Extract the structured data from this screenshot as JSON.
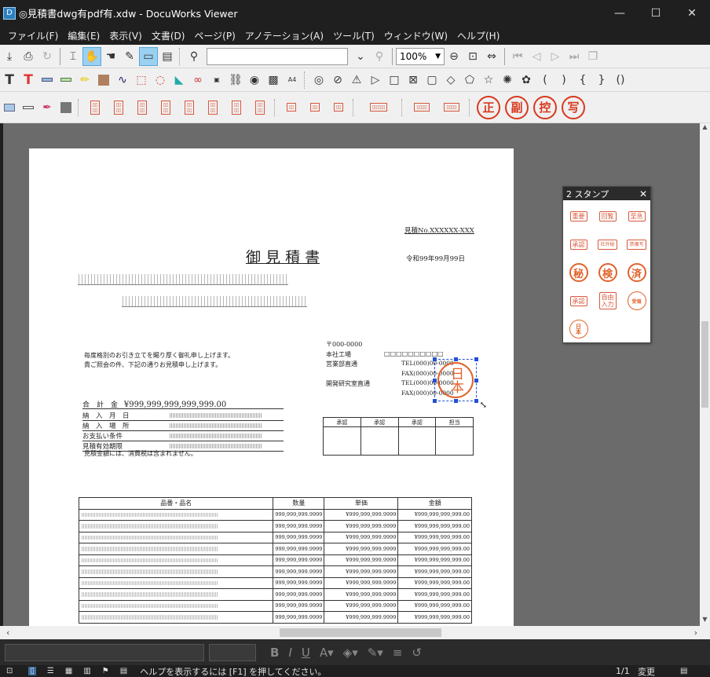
{
  "window": {
    "title": "◎見積書dwg有pdf有.xdw - DocuWorks Viewer",
    "app_icon": "docuworks-icon",
    "minimize": "—",
    "maximize": "☐",
    "close": "✕"
  },
  "menu": [
    "ファイル(F)",
    "編集(E)",
    "表示(V)",
    "文書(D)",
    "ページ(P)",
    "アノテーション(A)",
    "ツール(T)",
    "ウィンドウ(W)",
    "ヘルプ(H)"
  ],
  "toolbar": {
    "zoom": "100%",
    "search_placeholder": ""
  },
  "stamp_toolbar": {
    "big_stamps": [
      "正",
      "副",
      "控",
      "写"
    ]
  },
  "document": {
    "estimate_no": "見積No.XXXXXX-XXX",
    "title": "御 見 積 書",
    "date": "令和99年99月99日",
    "greeting_1": "毎度格別のお引き立てを賜り厚く御礼申し上げます。",
    "greeting_2": "貴ご照会の件、下記の通りお見積申し上げます。",
    "postal": "〒000-0000",
    "factory_label": "本社工場",
    "factory_value": "□□□□□□□□□□",
    "sales_label": "営業部直通",
    "lab_label": "開発研究室直通",
    "tel_1": "TEL(000)00-0000",
    "fax_1": "FAX(000)00-0000",
    "tel_2": "TEL(000)00-0000",
    "fax_2": "FAX(000)00-0000",
    "total_label": "合　計　金",
    "total_value": "¥999,999,999,999,999.00",
    "fields": [
      "納　入　月　日",
      "納　入　場　所",
      "お支払い条件",
      "見積有効期限"
    ],
    "tax_note": "見積金額には、消費税は含まれません。",
    "approvals": [
      "承認",
      "承認",
      "承認",
      "担当"
    ],
    "table_headers": [
      "品番・品名",
      "数量",
      "単価",
      "金額"
    ],
    "row_qty": "999,999,999.9999",
    "row_price": "¥999,999,999.9999",
    "row_amount": "¥999,999,999,999.00",
    "stamp_text": "日本"
  },
  "stamp_panel": {
    "title": "2 スタンプ",
    "stamps": [
      "重要",
      "回覧",
      "至急",
      "承認",
      "社外秘",
      "禁複写",
      "秘",
      "検",
      "済",
      "承認",
      "自由入力",
      "受領",
      "日本"
    ]
  },
  "statusbar": {
    "help": "ヘルプを表示するには [F1] を押してください。",
    "page": "1/1",
    "mode": "変更"
  }
}
